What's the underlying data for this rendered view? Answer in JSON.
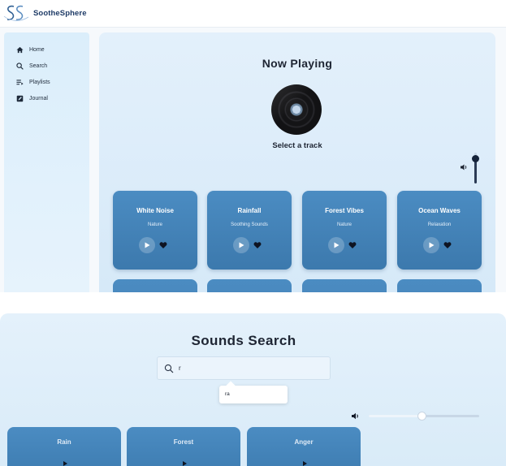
{
  "header": {
    "brand": "SootheSphere",
    "logo_icon": "logo-ss-icon"
  },
  "sidebar": {
    "items": [
      {
        "label": "Home",
        "icon": "home-icon"
      },
      {
        "label": "Search",
        "icon": "search-icon"
      },
      {
        "label": "Playlists",
        "icon": "playlist-icon"
      },
      {
        "label": "Journal",
        "icon": "journal-icon"
      }
    ]
  },
  "player": {
    "title": "Now Playing",
    "status": "Select a track",
    "volume_level": 0.8
  },
  "tracks": [
    {
      "title": "White Noise",
      "category": "Nature"
    },
    {
      "title": "Rainfall",
      "category": "Soothing Sounds"
    },
    {
      "title": "Forest Vibes",
      "category": "Nature"
    },
    {
      "title": "Ocean Waves",
      "category": "Relaxation"
    }
  ],
  "search_page": {
    "title": "Sounds Search",
    "query": "r",
    "suggestion": "ra",
    "volume_level": 0.48,
    "results": [
      {
        "title": "Rain"
      },
      {
        "title": "Forest"
      },
      {
        "title": "Anger"
      }
    ]
  },
  "colors": {
    "card": "#4585bb",
    "brand_text": "#1d3a66",
    "panel": "#dcecf9"
  }
}
